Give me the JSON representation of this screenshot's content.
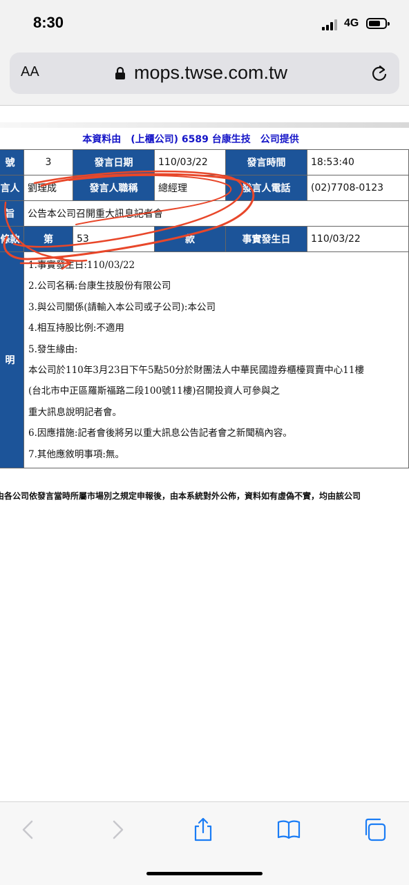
{
  "status_bar": {
    "time": "8:30",
    "network": "4G"
  },
  "address_bar": {
    "aa_label": "AA",
    "url": "mops.twse.com.tw"
  },
  "page": {
    "provider_note": "本資料由　(上櫃公司) 6589 台康生技　公司提供",
    "rows": {
      "row1": {
        "label_no": "號",
        "no_value": "3",
        "label_date": "發言日期",
        "date_value": "110/03/22",
        "label_time": "發言時間",
        "time_value": "18:53:40"
      },
      "row2": {
        "label_speaker": "言人",
        "speaker_value": "劉理成",
        "label_title": "發言人職稱",
        "title_value": "總經理",
        "label_phone": "發言人電話",
        "phone_value": "(02)7708-0123"
      },
      "row3": {
        "label_subject": "旨",
        "subject_value": "公告本公司召開重大訊息記者會"
      },
      "row4": {
        "label_clause": "條款",
        "label_di": "第",
        "clause_value": "53",
        "label_kuan": "款",
        "label_fact_date": "事實發生日",
        "fact_date_value": "110/03/22"
      },
      "row5": {
        "label_desc": "明",
        "lines": [
          "1.事實發生日:110/03/22",
          "2.公司名稱:台康生技股份有限公司",
          "3.與公司關係(請輸入本公司或子公司):本公司",
          "4.相互持股比例:不適用",
          "5.發生緣由:",
          "  本公司於110年3月23日下午5點50分於財團法人中華民國證券櫃檯買賣中心11樓",
          "(台北市中正區羅斯福路二段100號11樓)召開投資人可參與之",
          "  重大訊息說明記者會。",
          "6.因應措施:記者會後將另以重大訊息公告記者會之新聞稿內容。",
          "7.其他應敘明事項:無。"
        ]
      }
    },
    "disclaimer": "由各公司依發言當時所屬市場別之規定申報後，由本系統對外公佈，資料如有虛偽不實，均由該公司"
  },
  "toolbar": {
    "back_icon": "chevron-left-icon",
    "forward_icon": "chevron-right-icon",
    "share_icon": "share-icon",
    "bookmarks_icon": "book-icon",
    "tabs_icon": "tabs-icon"
  },
  "colors": {
    "header_bg": "#1c5499",
    "provider_text": "#1515c8",
    "annotation": "#e8472a"
  }
}
